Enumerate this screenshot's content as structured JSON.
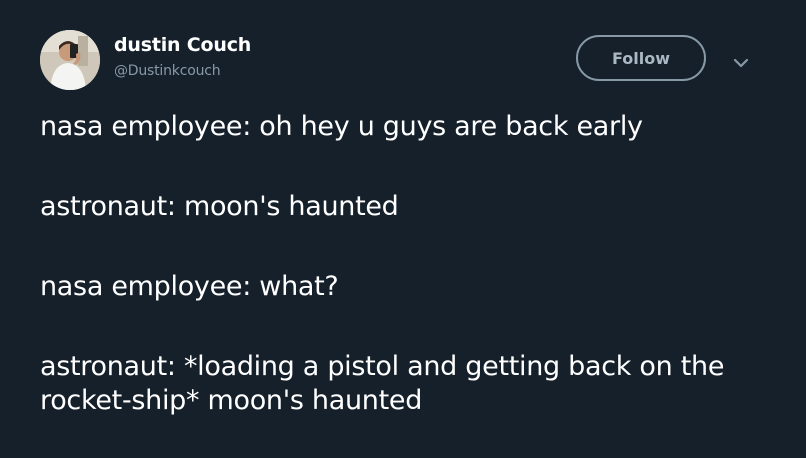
{
  "user": {
    "display_name": "dustin Couch",
    "handle": "@Dustinkcouch"
  },
  "actions": {
    "follow_label": "Follow",
    "menu_icon": "chevron-down-icon"
  },
  "tweet": {
    "lines": [
      "nasa employee: oh hey u guys are back early",
      "astronaut: moon's haunted",
      "nasa employee: what?",
      "astronaut: *loading a pistol and getting back on the rocket-ship* moon's haunted"
    ]
  },
  "colors": {
    "background": "#15202b",
    "text": "#ffffff",
    "secondary_text": "#8899a6"
  }
}
